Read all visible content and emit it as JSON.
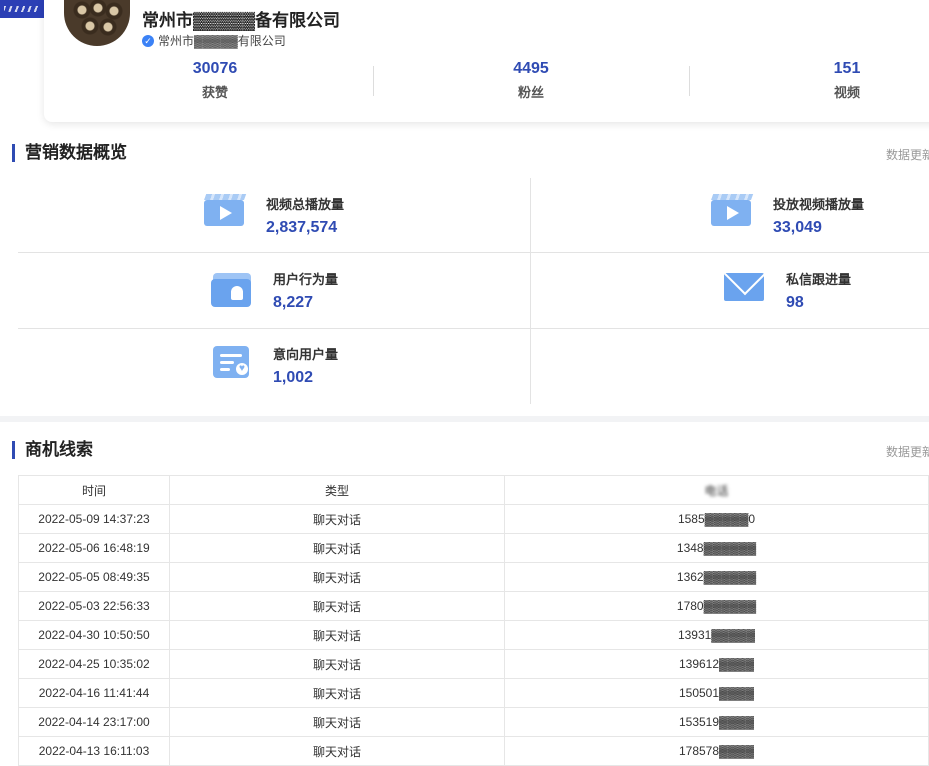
{
  "profile": {
    "company_name": "常州市▓▓▓▓▓备有限公司",
    "verified_name": "常州市▓▓▓▓▓有限公司",
    "stats": [
      {
        "value": "30076",
        "label": "获赞"
      },
      {
        "value": "4495",
        "label": "粉丝"
      },
      {
        "value": "151",
        "label": "视频"
      }
    ]
  },
  "overview": {
    "title": "营销数据概览",
    "update_note": "数据更新",
    "metrics": [
      {
        "label": "视频总播放量",
        "value": "2,837,574",
        "icon": "video-icon"
      },
      {
        "label": "投放视频播放量",
        "value": "33,049",
        "icon": "video-icon"
      },
      {
        "label": "用户行为量",
        "value": "8,227",
        "icon": "user-folder-icon"
      },
      {
        "label": "私信跟进量",
        "value": "98",
        "icon": "mail-icon"
      },
      {
        "label": "意向用户量",
        "value": "1,002",
        "icon": "intent-card-icon"
      }
    ]
  },
  "leads": {
    "title": "商机线索",
    "update_note": "数据更新",
    "columns": [
      "时间",
      "类型",
      "电话"
    ],
    "rows": [
      {
        "time": "2022-05-09 14:37:23",
        "type": "聊天对话",
        "phone": "1585▓▓▓▓▓0"
      },
      {
        "time": "2022-05-06 16:48:19",
        "type": "聊天对话",
        "phone": "1348▓▓▓▓▓▓"
      },
      {
        "time": "2022-05-05 08:49:35",
        "type": "聊天对话",
        "phone": "1362▓▓▓▓▓▓"
      },
      {
        "time": "2022-05-03 22:56:33",
        "type": "聊天对话",
        "phone": "1780▓▓▓▓▓▓"
      },
      {
        "time": "2022-04-30 10:50:50",
        "type": "聊天对话",
        "phone": "13931▓▓▓▓▓"
      },
      {
        "time": "2022-04-25 10:35:02",
        "type": "聊天对话",
        "phone": "139612▓▓▓▓"
      },
      {
        "time": "2022-04-16 11:41:44",
        "type": "聊天对话",
        "phone": "150501▓▓▓▓"
      },
      {
        "time": "2022-04-14 23:17:00",
        "type": "聊天对话",
        "phone": "153519▓▓▓▓"
      },
      {
        "time": "2022-04-13 16:11:03",
        "type": "聊天对话",
        "phone": "178578▓▓▓▓"
      }
    ]
  },
  "colors": {
    "accent": "#2f4bb3",
    "icon_blue": "#7fb1f1",
    "divider": "#e3e3e3"
  }
}
